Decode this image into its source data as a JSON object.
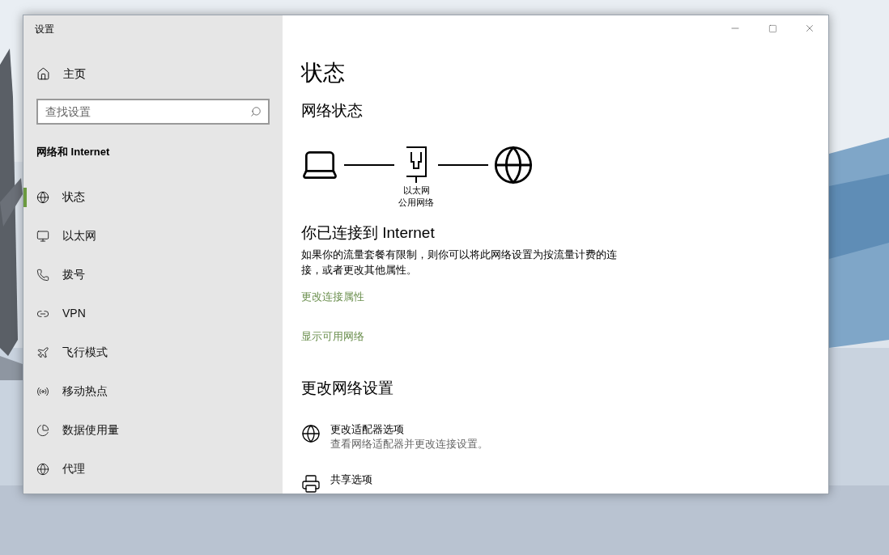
{
  "window": {
    "title": "设置"
  },
  "sidebar": {
    "home": "主页",
    "search": {
      "placeholder": "查找设置"
    },
    "section": "网络和 Internet",
    "items": [
      {
        "label": "状态",
        "selected": true
      },
      {
        "label": "以太网",
        "selected": false
      },
      {
        "label": "拨号",
        "selected": false
      },
      {
        "label": "VPN",
        "selected": false
      },
      {
        "label": "飞行模式",
        "selected": false
      },
      {
        "label": "移动热点",
        "selected": false
      },
      {
        "label": "数据使用量",
        "selected": false
      },
      {
        "label": "代理",
        "selected": false
      }
    ]
  },
  "content": {
    "title": "状态",
    "subtitle": "网络状态",
    "diagram": {
      "adapter": "以太网",
      "network": "公用网络"
    },
    "connected_title": "你已连接到 Internet",
    "connected_text": "如果你的流量套餐有限制，则你可以将此网络设置为按流量计费的连接，或者更改其他属性。",
    "links": [
      "更改连接属性",
      "显示可用网络"
    ],
    "section": "更改网络设置",
    "options": [
      {
        "title": "更改适配器选项",
        "description": "查看网络适配器并更改连接设置。"
      },
      {
        "title": "共享选项"
      }
    ]
  }
}
